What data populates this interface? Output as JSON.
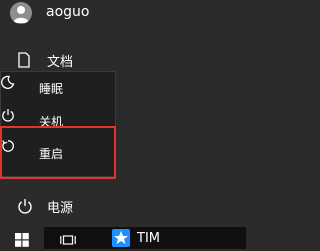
{
  "user": {
    "name": "aoguo"
  },
  "items": {
    "documents": "文档",
    "sleep": "睡眠",
    "shutdown": "关机",
    "restart": "重启",
    "power": "电源"
  },
  "taskbar": {
    "app_label": "TIM"
  },
  "colors": {
    "highlight": "#e0352c",
    "tim": "#1e90ff"
  }
}
